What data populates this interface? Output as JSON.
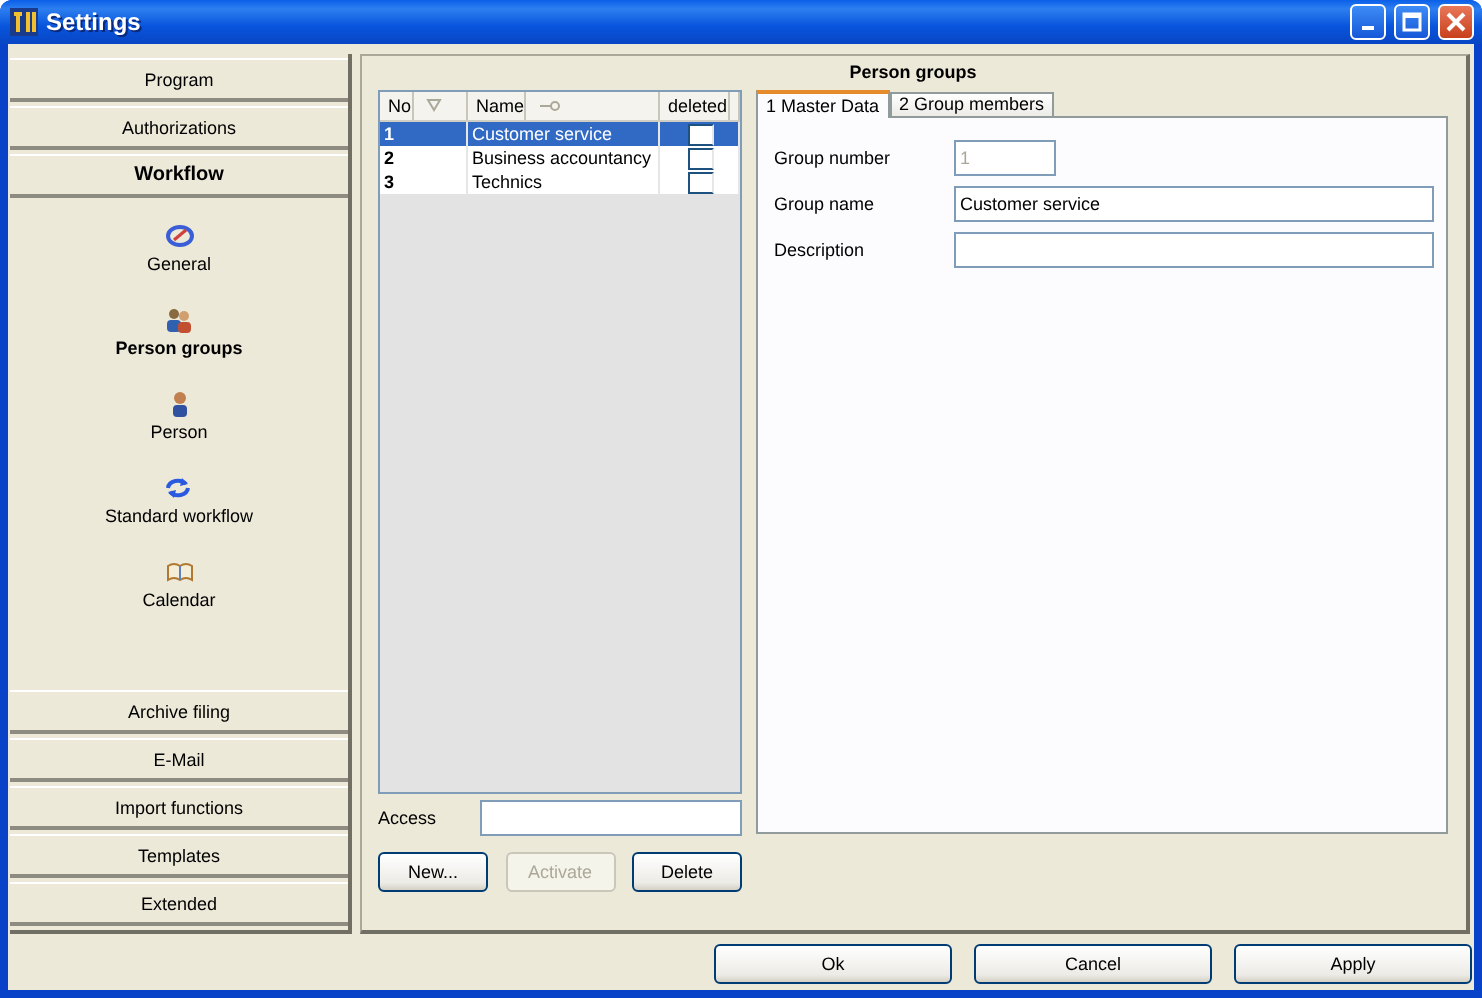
{
  "window": {
    "title": "Settings"
  },
  "sidebar": {
    "sections_top": [
      {
        "label": "Program",
        "selected": false
      },
      {
        "label": "Authorizations",
        "selected": false
      },
      {
        "label": "Workflow",
        "selected": true
      }
    ],
    "items": [
      {
        "label": "General",
        "kind": "general",
        "selected": false
      },
      {
        "label": "Person groups",
        "kind": "groups",
        "selected": true
      },
      {
        "label": "Person",
        "kind": "person",
        "selected": false
      },
      {
        "label": "Standard workflow",
        "kind": "workflow",
        "selected": false
      },
      {
        "label": "Calendar",
        "kind": "calendar",
        "selected": false
      }
    ],
    "sections_bottom": [
      {
        "label": "Archive filing",
        "selected": false
      },
      {
        "label": "E-Mail",
        "selected": false
      },
      {
        "label": "Import functions",
        "selected": false
      },
      {
        "label": "Templates",
        "selected": false
      },
      {
        "label": "Extended",
        "selected": false
      }
    ]
  },
  "panel": {
    "title": "Person groups"
  },
  "grid": {
    "columns": [
      "No",
      "Name",
      "deleted"
    ],
    "rows": [
      {
        "no": "1",
        "name": "Customer service",
        "deleted": false,
        "selected": true
      },
      {
        "no": "2",
        "name": "Business accountancy",
        "deleted": false,
        "selected": false
      },
      {
        "no": "3",
        "name": "Technics",
        "deleted": false,
        "selected": false
      }
    ]
  },
  "access": {
    "label": "Access"
  },
  "list_buttons": [
    {
      "label": "New...",
      "disabled": false
    },
    {
      "label": "Activate",
      "disabled": true
    },
    {
      "label": "Delete",
      "disabled": false
    }
  ],
  "tabs": [
    {
      "label": "1 Master Data",
      "selected": true
    },
    {
      "label": "2 Group members",
      "selected": false
    }
  ],
  "fields": [
    {
      "label": "Group number",
      "value": "1",
      "disabled": true
    },
    {
      "label": "Group name",
      "value": "Customer service",
      "disabled": false
    },
    {
      "label": "Description",
      "disabled": false
    }
  ],
  "dialog_buttons": [
    "Ok",
    "Cancel",
    "Apply"
  ]
}
